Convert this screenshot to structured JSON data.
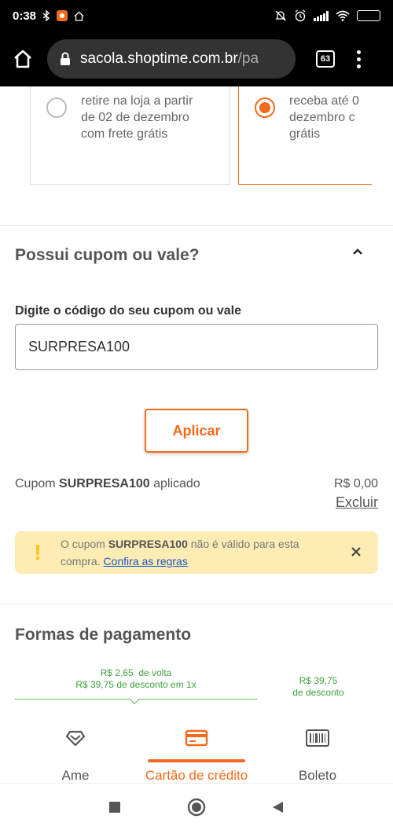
{
  "status_bar": {
    "time": "0:38",
    "battery": "68"
  },
  "browser": {
    "url_host": "sacola.shoptime.com.br",
    "url_path": "/pa",
    "tab_count": "63"
  },
  "delivery": {
    "pickup_text": "retire na loja a partir\nde 02 de dezembro\ncom frete grátis",
    "ship_text": "receba até 0\ndezembro c\ngrátis"
  },
  "coupon": {
    "title": "Possui cupom ou vale?",
    "input_label": "Digite o código do seu cupom ou vale",
    "input_value": "SURPRESA100",
    "apply_label": "Aplicar",
    "applied_prefix": "Cupom ",
    "applied_code": "SURPRESA100",
    "applied_suffix": " aplicado",
    "applied_value": "R$ 0,00",
    "remove_label": "Excluir"
  },
  "alert": {
    "prefix": "O cupom ",
    "code": "SURPRESA100",
    "suffix": " não é válido para esta compra. ",
    "link": "Confira as regras"
  },
  "payment": {
    "title": "Formas de pagamento",
    "ame_promo_line1": "R$ 2,65  de volta",
    "ame_promo_line2": "R$ 39,75 de desconto em 1x",
    "boleto_promo_line1": "R$ 39,75",
    "boleto_promo_line2": "de desconto",
    "tabs": [
      {
        "label": "Ame"
      },
      {
        "label": "Cartão de crédito"
      },
      {
        "label": "Boleto"
      }
    ]
  },
  "colors": {
    "accent": "#f26a1b",
    "promo_green": "#3ea33e",
    "alert_bg": "#fdedb4",
    "link_blue": "#1a53c9"
  }
}
